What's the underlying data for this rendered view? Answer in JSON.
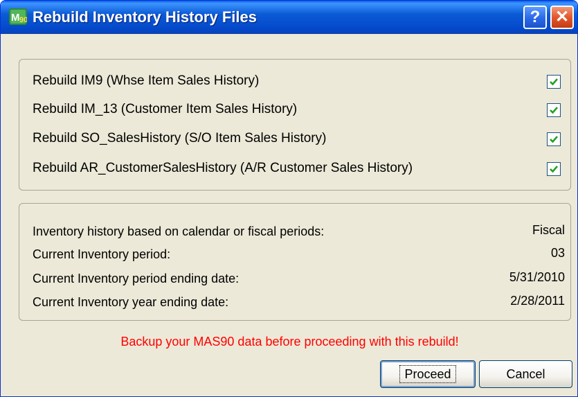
{
  "window": {
    "title": "Rebuild Inventory History Files",
    "help_label": "?",
    "close_label": "✕",
    "icon": "mas90-app-icon"
  },
  "rebuild_options": [
    {
      "label": "Rebuild IM9 (Whse Item Sales History)",
      "checked": true
    },
    {
      "label": "Rebuild IM_13 (Customer Item Sales History)",
      "checked": true
    },
    {
      "label": "Rebuild SO_SalesHistory (S/O Item Sales History)",
      "checked": true
    },
    {
      "label": "Rebuild AR_CustomerSalesHistory (A/R Customer Sales History)",
      "checked": true
    }
  ],
  "info": [
    {
      "label": "Inventory history based on calendar or fiscal periods:",
      "value": "Fiscal"
    },
    {
      "label": "Current Inventory period:",
      "value": "03"
    },
    {
      "label": "Current Inventory period ending date:",
      "value": "5/31/2010"
    },
    {
      "label": "Current Inventory year ending date:",
      "value": "2/28/2011"
    }
  ],
  "warning": "Backup your MAS90 data before proceeding with this rebuild!",
  "buttons": {
    "proceed": "Proceed",
    "cancel": "Cancel"
  },
  "colors": {
    "warning_text": "#ff0000",
    "titlebar": "#0347c9",
    "dialog_bg": "#ece9d8"
  }
}
